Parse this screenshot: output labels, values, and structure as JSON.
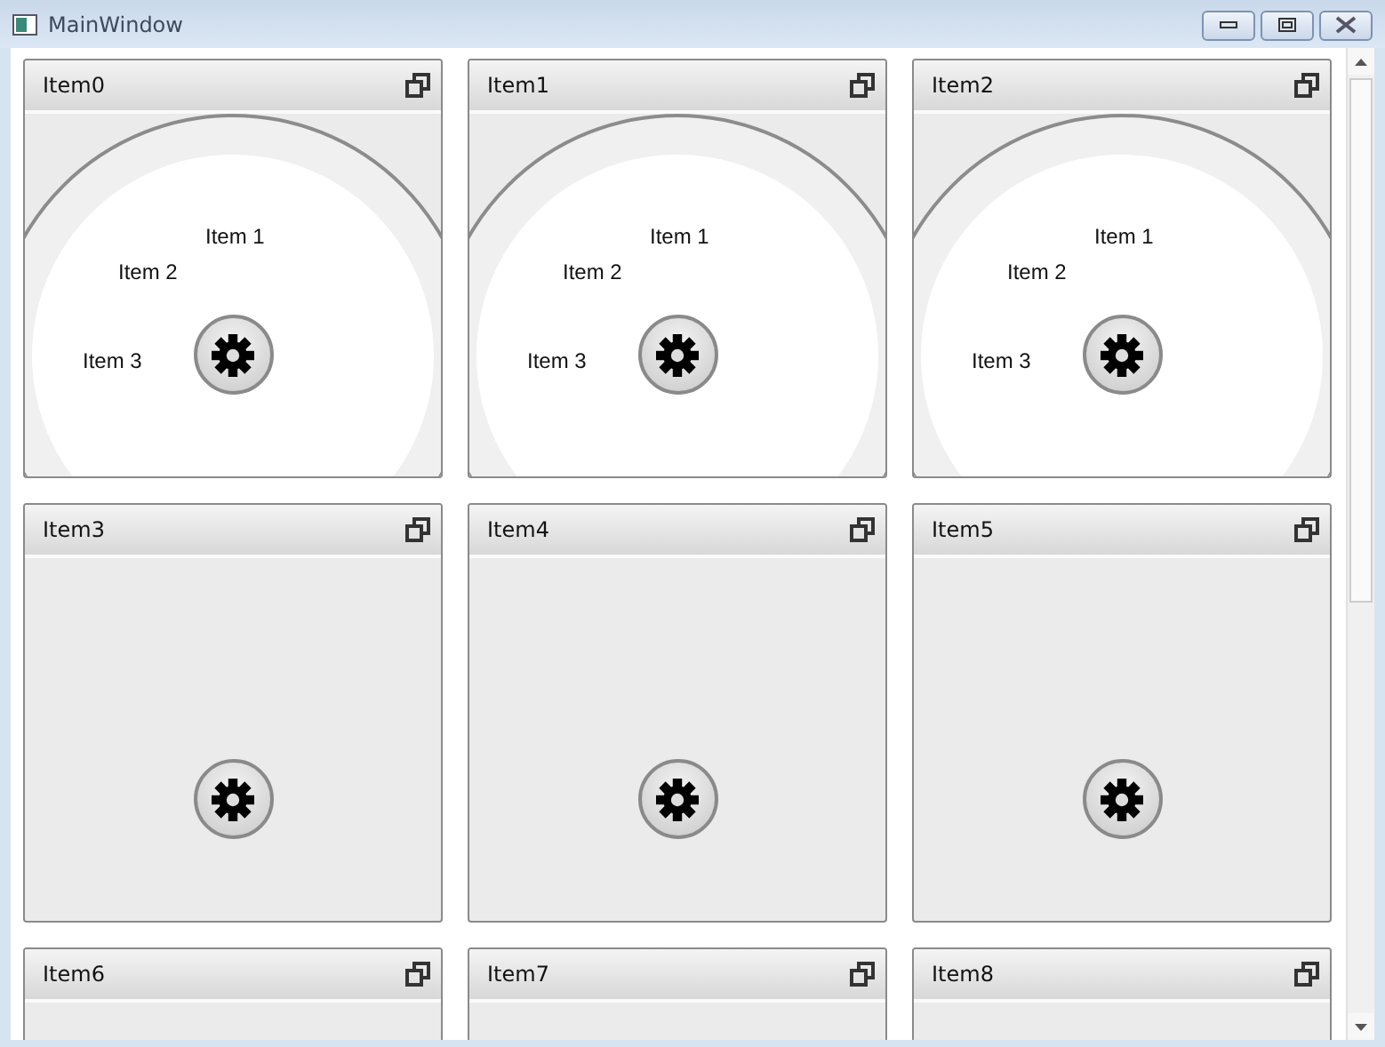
{
  "window": {
    "title": "MainWindow"
  },
  "tiles": [
    {
      "title": "Item0",
      "expanded": true,
      "menu_items": [
        "Item 1",
        "Item 2",
        "Item 3"
      ]
    },
    {
      "title": "Item1",
      "expanded": true,
      "menu_items": [
        "Item 1",
        "Item 2",
        "Item 3"
      ]
    },
    {
      "title": "Item2",
      "expanded": true,
      "menu_items": [
        "Item 1",
        "Item 2",
        "Item 3"
      ]
    },
    {
      "title": "Item3",
      "expanded": false
    },
    {
      "title": "Item4",
      "expanded": false
    },
    {
      "title": "Item5",
      "expanded": false
    },
    {
      "title": "Item6",
      "expanded": false
    },
    {
      "title": "Item7",
      "expanded": false
    },
    {
      "title": "Item8",
      "expanded": false
    }
  ]
}
